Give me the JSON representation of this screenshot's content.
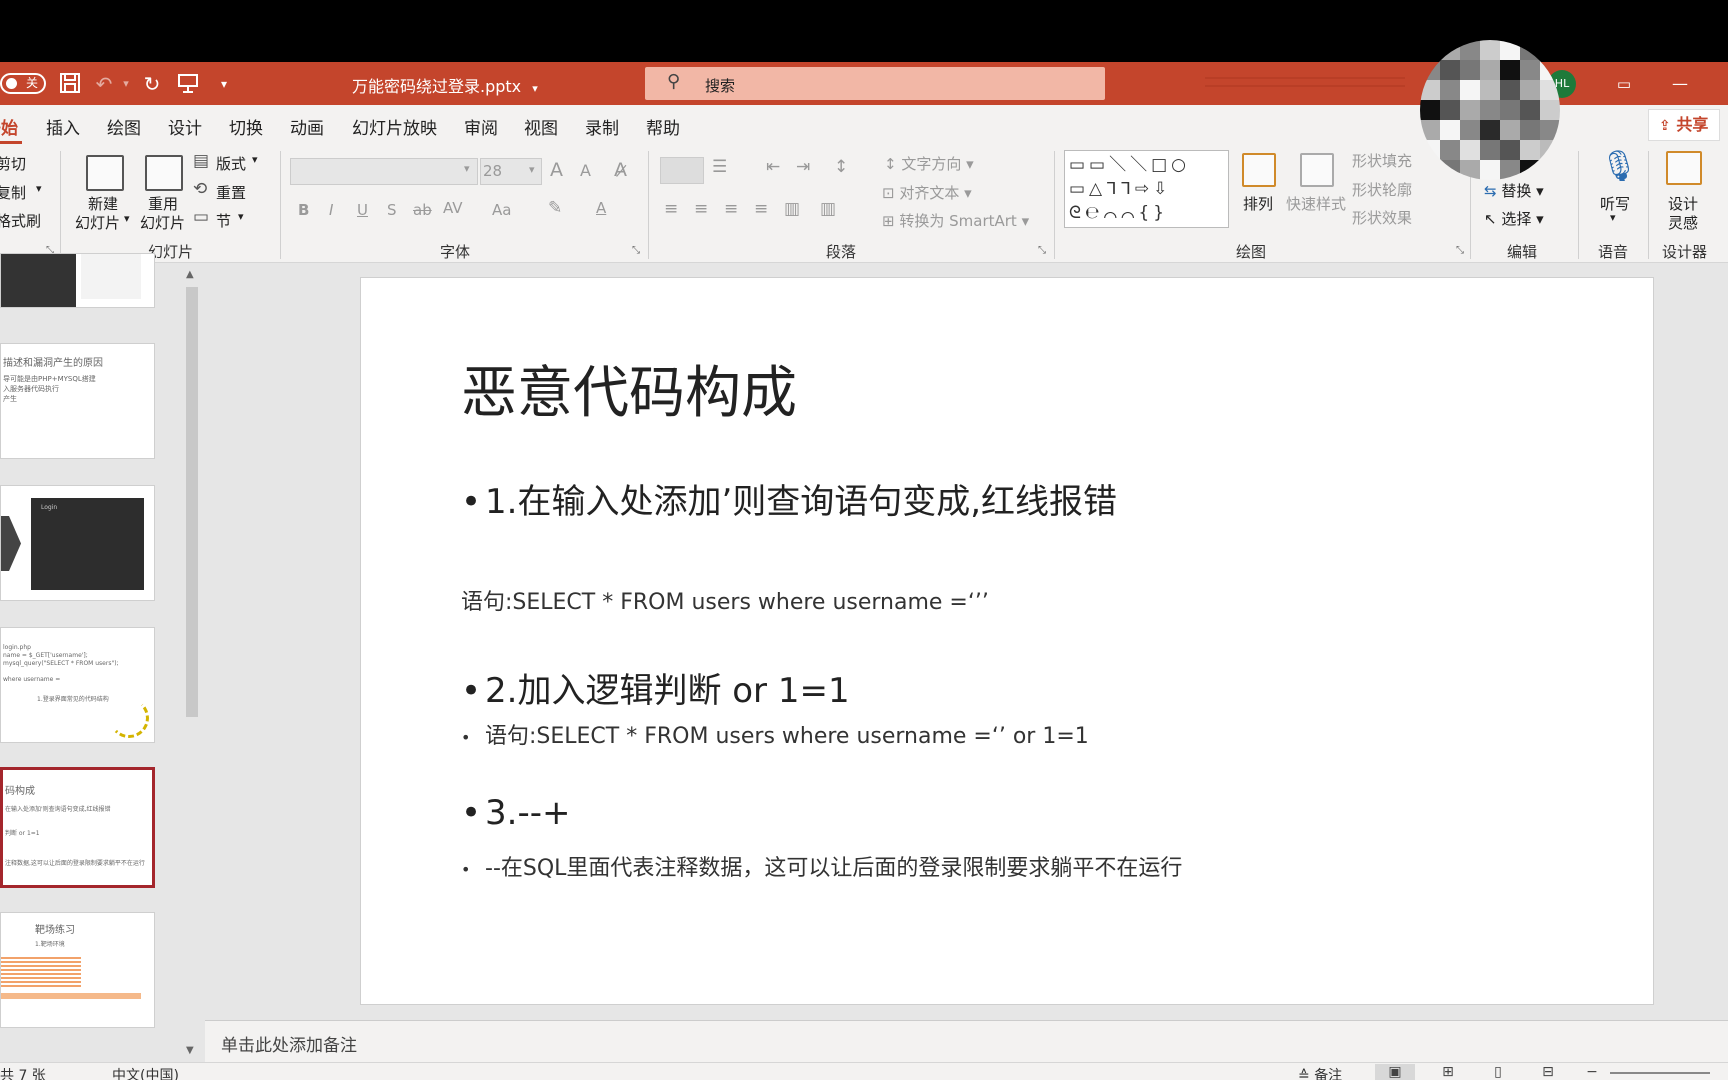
{
  "titlebar": {
    "autosave_label": "关",
    "filename": "万能密码绕过登录.pptx",
    "search_placeholder": "搜索",
    "user_initials": "HL",
    "undo_icon": "undo-icon",
    "redo_icon": "redo-icon",
    "save_icon": "save-icon"
  },
  "ribbon_tabs": [
    {
      "label": "开始"
    },
    {
      "label": "插入"
    },
    {
      "label": "绘图"
    },
    {
      "label": "设计"
    },
    {
      "label": "切换"
    },
    {
      "label": "动画"
    },
    {
      "label": "幻灯片放映"
    },
    {
      "label": "审阅"
    },
    {
      "label": "视图"
    },
    {
      "label": "录制"
    },
    {
      "label": "帮助"
    }
  ],
  "share_label": "共享",
  "ribbon": {
    "clipboard": {
      "cut": "剪切",
      "copy": "复制",
      "format_painter": "格式刷"
    },
    "slides": {
      "new_slide_1": "新建",
      "new_slide_2": "幻灯片",
      "reuse_1": "重用",
      "reuse_2": "幻灯片",
      "layout": "版式",
      "reset": "重置",
      "section": "节",
      "group_label": "幻灯片"
    },
    "font": {
      "size": "28",
      "group_label": "字体",
      "bold": "B",
      "italic": "I",
      "underline": "U",
      "shadow": "S",
      "strike": "ab",
      "spacing": "AV",
      "case": "Aa",
      "grow": "A",
      "shrink": "A"
    },
    "paragraph": {
      "text_direction": "文字方向",
      "align_text": "对齐文本",
      "smartart": "转换为 SmartArt",
      "group_label": "段落"
    },
    "drawing": {
      "shapes_row1": "▭▭＼＼□○",
      "shapes_row2": "▭△ᒣᒣ⇨⇩",
      "shapes_row3": "ᘓ℮⌒⌒{}",
      "arrange": "排列",
      "quick_styles": "快速样式",
      "shape_fill": "形状填充",
      "shape_outline": "形状轮廓",
      "shape_effects": "形状效果",
      "group_label": "绘图"
    },
    "editing": {
      "replace": "替换",
      "select": "选择",
      "group_label": "编辑"
    },
    "voice": {
      "dictate": "听写",
      "group_label": "语音"
    },
    "designer": {
      "ideas_1": "设计",
      "ideas_2": "灵感",
      "group_label": "设计器"
    }
  },
  "thumbnails": [
    {
      "title": "",
      "lines": []
    },
    {
      "title": "描述和漏洞产生的原因",
      "lines": [
        "导可能是由PHP+MYSQL搭建",
        "入服务器代码执行",
        "产生"
      ]
    },
    {
      "title": "",
      "lines": [
        "Login"
      ]
    },
    {
      "title": "",
      "lines": [
        "login.php",
        "name = $_GET['username'];",
        "mysql_query(\"SELECT * FROM users\");",
        "where username =",
        "1.登录界面常见的代码结构"
      ]
    },
    {
      "title": "码构成",
      "lines": [
        "在输入处添加'则查询语句变成,红线报错",
        "判断 or 1=1",
        "注释数据,这可以让后面的登录限制要求躺平不在运行"
      ]
    },
    {
      "title": "靶场练习",
      "lines": [
        "1.靶场环境"
      ]
    }
  ],
  "slide": {
    "title": "恶意代码构成",
    "bullet1": "1.在输入处添加’则查询语句变成,红线报错",
    "plain1": "语句:SELECT * FROM users where username =‘’’",
    "bullet2": "2.加入逻辑判断 or 1=1",
    "sub2": "语句:SELECT * FROM users where username =‘’ or 1=1",
    "bullet3": "3.--+",
    "sub3": "--在SQL里面代表注释数据，这可以让后面的登录限制要求躺平不在运行"
  },
  "notes_placeholder": "单击此处添加备注",
  "statusbar": {
    "slide_count": "共 7 张",
    "language": "中文(中国)",
    "notes_btn": "备注"
  }
}
